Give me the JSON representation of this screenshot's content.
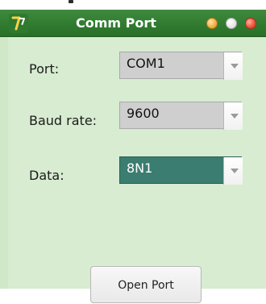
{
  "window": {
    "title": "Comm Port",
    "colors": {
      "title_bar": "#2f7a2f",
      "background": "#d7ecd0",
      "combo_selected": "#3b7d70"
    }
  },
  "form": {
    "port": {
      "label": "Port:",
      "value": "COM1"
    },
    "baud_rate": {
      "label": "Baud rate:",
      "value": "9600"
    },
    "data": {
      "label": "Data:",
      "value": "8N1"
    }
  },
  "actions": {
    "open_port_label": "Open Port"
  },
  "icons": {
    "app": "app-icon",
    "minimize": "minimize-icon",
    "maximize": "maximize-icon",
    "close": "close-icon",
    "dropdown": "chevron-down-icon"
  }
}
